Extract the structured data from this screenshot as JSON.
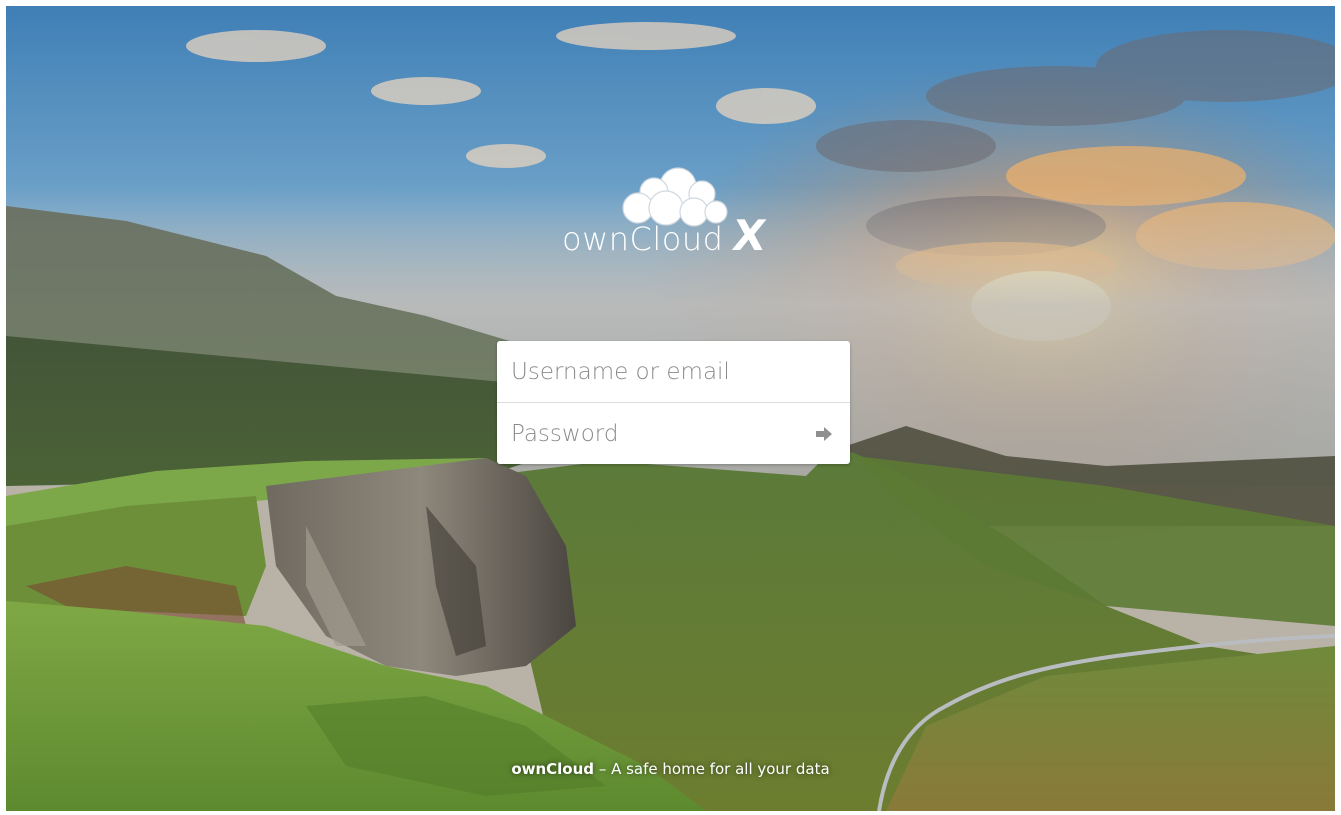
{
  "app": {
    "name": "ownCloud",
    "edition": "X"
  },
  "login": {
    "username_placeholder": "Username or email",
    "password_placeholder": "Password",
    "username_value": "",
    "password_value": "",
    "submit_icon": "arrow-right-icon"
  },
  "footer": {
    "brand": "ownCloud",
    "tagline": "– A safe home for all your data"
  },
  "colors": {
    "sky_top": "#4d86b8",
    "sun_glow": "#f6c66a",
    "grass": "#6d9a35",
    "login_bg": "#ffffff",
    "placeholder": "#8a8a8a",
    "text_light": "#ffffff"
  }
}
